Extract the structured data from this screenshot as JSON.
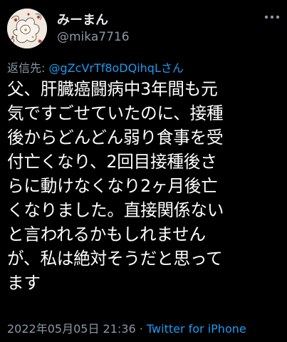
{
  "author": {
    "display_name": "みーまん",
    "handle": "@mika7716",
    "avatar_icon": "flower-avatar-icon"
  },
  "more_icon": "more-dots-icon",
  "reply": {
    "prefix": "返信先: ",
    "target": "@gZcVrTf8oDQihqLさん"
  },
  "body_lines": [
    "父、肝臓癌闘病中3年間も元",
    "気ですごせていたのに、接種",
    "後からどんどん弱り食事を受",
    "付亡くなり、2回目接種後さ",
    "らに動けなくなり2ヶ月後亡",
    "くなりました。直接関係ない",
    "と言われるかもしれません",
    "が、私は絶対そうだと思って",
    "ます"
  ],
  "meta": {
    "timestamp": "2022年05月05日 21:36",
    "separator": " · ",
    "source": "Twitter for iPhone"
  },
  "colors": {
    "background": "#000000",
    "text": "#ffffff",
    "secondary": "#8b98a5",
    "link": "#1d9bf0"
  }
}
